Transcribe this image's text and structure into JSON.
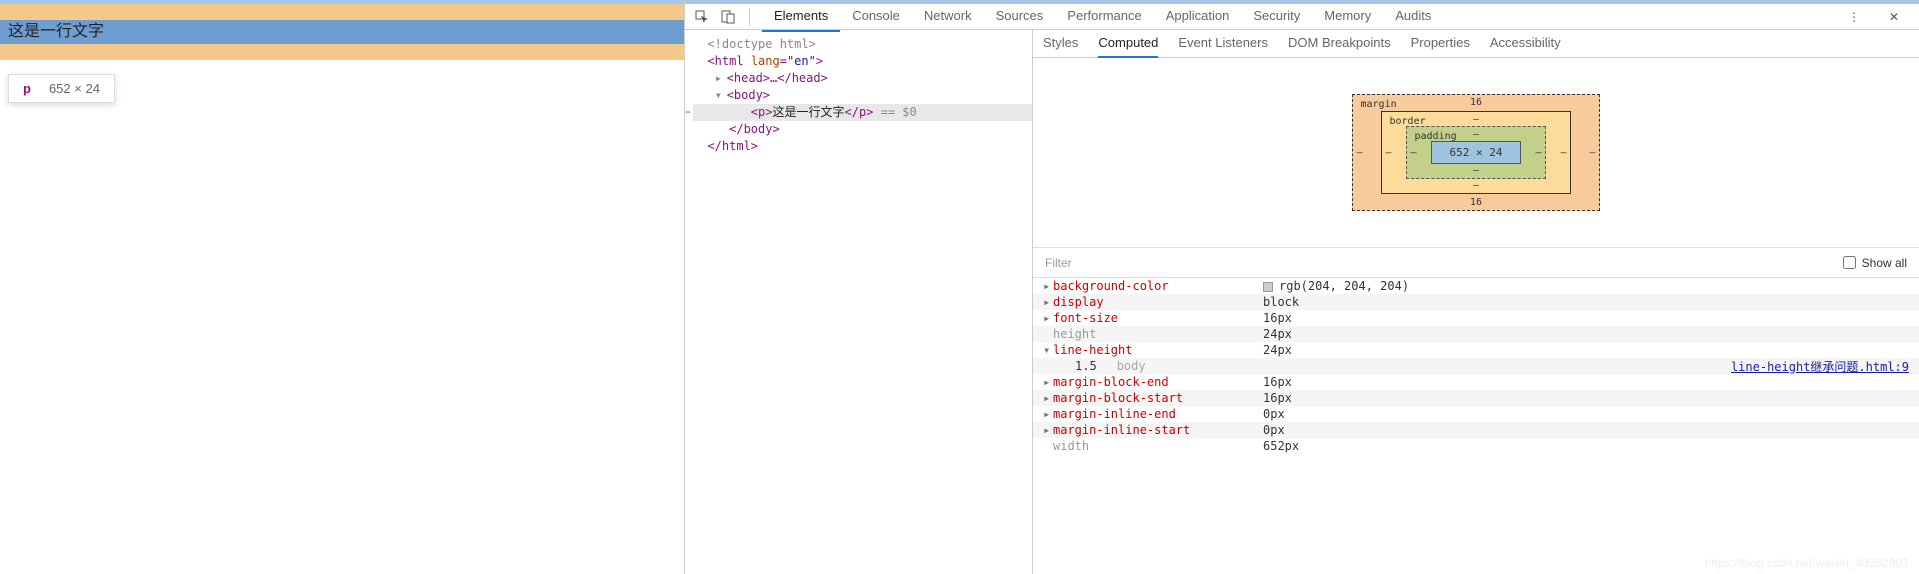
{
  "page": {
    "paragraph_text": "这是一行文字"
  },
  "tooltip": {
    "tag": "p",
    "dimensions": "652 × 24"
  },
  "devtools": {
    "main_tabs": [
      "Elements",
      "Console",
      "Network",
      "Sources",
      "Performance",
      "Application",
      "Security",
      "Memory",
      "Audits"
    ],
    "main_active": "Elements",
    "side_tabs": [
      "Styles",
      "Computed",
      "Event Listeners",
      "DOM Breakpoints",
      "Properties",
      "Accessibility"
    ],
    "side_active": "Computed",
    "filter_placeholder": "Filter",
    "show_all_label": "Show all"
  },
  "elements_source": {
    "l0": "<!doctype html>",
    "l1_open": "<html ",
    "l1_attr_n": "lang",
    "l1_attr_v": "\"en\"",
    "l1_close": ">",
    "l2": "<head>…</head>",
    "l3": "<body>",
    "l4_open": "<p>",
    "l4_text": "这是一行文字",
    "l4_close": "</p>",
    "l4_tail": " == $0",
    "l5": "</body>",
    "l6": "</html>"
  },
  "boxmodel": {
    "margin_label": "margin",
    "border_label": "border",
    "padding_label": "padding",
    "content": "652 × 24",
    "margin_top": "16",
    "margin_bottom": "16",
    "margin_left": "–",
    "margin_right": "–",
    "border_v": "–",
    "padding_v": "–"
  },
  "computed": [
    {
      "tri": "▸",
      "name": "background-color",
      "val": "rgb(204, 204, 204)",
      "swatch": "#cccccc"
    },
    {
      "tri": "▸",
      "name": "display",
      "val": "block"
    },
    {
      "tri": "▸",
      "name": "font-size",
      "val": "16px"
    },
    {
      "tri": "",
      "name": "height",
      "val": "24px",
      "dim": true
    },
    {
      "tri": "▾",
      "name": "line-height",
      "val": "24px"
    },
    {
      "tri": "",
      "indent": true,
      "name": "1.5",
      "origin": "body",
      "link": "line-height继承问题.html:9"
    },
    {
      "tri": "▸",
      "name": "margin-block-end",
      "val": "16px"
    },
    {
      "tri": "▸",
      "name": "margin-block-start",
      "val": "16px"
    },
    {
      "tri": "▸",
      "name": "margin-inline-end",
      "val": "0px"
    },
    {
      "tri": "▸",
      "name": "margin-inline-start",
      "val": "0px"
    },
    {
      "tri": "",
      "name": "width",
      "val": "652px",
      "dim": true
    }
  ],
  "watermark": "https://blog.csdn.net/weixin_43352901"
}
